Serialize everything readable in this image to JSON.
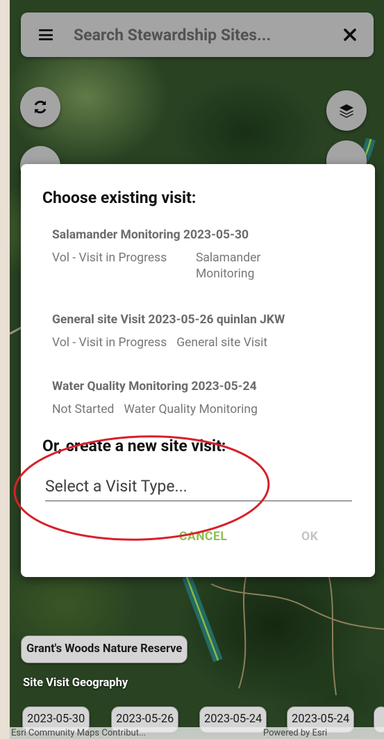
{
  "search": {
    "placeholder": "Search Stewardship Sites..."
  },
  "icons": {
    "menu": "hamburger-menu-icon",
    "close": "close-x-icon",
    "refresh": "sync-refresh-icon",
    "layers": "layers-icon"
  },
  "dialog": {
    "title": "Choose existing visit:",
    "visits": [
      {
        "name": "Salamander Monitoring 2023-05-30",
        "status": "Vol - Visit in Progress",
        "type": "Salamander Monitoring"
      },
      {
        "name": "General site Visit 2023-05-26 quinlan JKW",
        "status": "Vol - Visit in Progress",
        "type": "General site Visit"
      },
      {
        "name": "Water Quality Monitoring 2023-05-24",
        "status": "Not Started",
        "type": "Water Quality Monitoring"
      }
    ],
    "new_title": "Or, create a new site visit:",
    "select_placeholder": "Select a Visit Type...",
    "cancel_label": "CANCEL",
    "ok_label": "OK"
  },
  "map": {
    "reserve_name": "Grant's Woods Nature Reserve",
    "geography_label": "Site Visit Geography",
    "dates": [
      "2023-05-30",
      "2023-05-26",
      "2023-05-24",
      "2023-05-24"
    ],
    "attribution_left": "Esri Community Maps Contribut...",
    "attribution_right": "Powered by Esri"
  },
  "colors": {
    "accent_green": "#8ec050",
    "annotation_red": "#d8202a",
    "ok_disabled": "#c4c4c4"
  }
}
